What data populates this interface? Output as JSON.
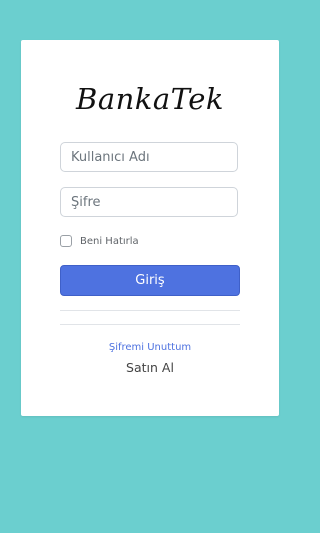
{
  "brand": {
    "name": "BankaTek"
  },
  "login_form": {
    "username_placeholder": "Kullanıcı Adı",
    "password_placeholder": "Şifre",
    "remember_label": "Beni Hatırla",
    "remember_checked": false,
    "submit_label": "Giriş"
  },
  "links": {
    "forgot_password": "Şifremi Unuttum",
    "buy": "Satın Al"
  },
  "colors": {
    "background": "#6bcfcf",
    "card": "#ffffff",
    "primary_button": "#4e72e0",
    "link": "#4e72e0"
  }
}
